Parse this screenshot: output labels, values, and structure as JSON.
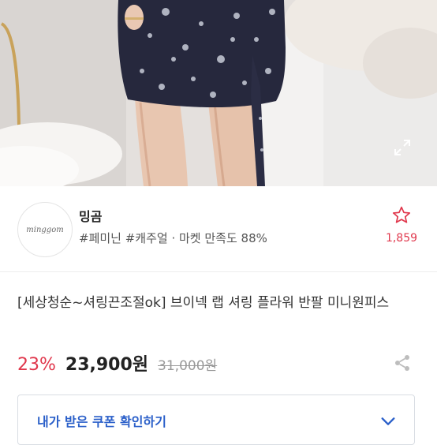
{
  "seller": {
    "logo_text": "minggom",
    "name": "밍곰",
    "tags": "#페미닌 #캐주얼 · 마켓 만족도 88%",
    "favorite_count": "1,859"
  },
  "product": {
    "title": "[세상청순~셔링끈조절ok] 브이넥 랩 셔링 플라워 반팔 미니원피스",
    "discount": "23%",
    "price": "23,900원",
    "original_price": "31,000원"
  },
  "coupon": {
    "label": "내가 받은 쿠폰 확인하기"
  },
  "colors": {
    "accent_red": "#e0374c",
    "coupon_blue": "#2a5fc9"
  },
  "icons": [
    "expand-icon",
    "star-outline-icon",
    "share-icon",
    "chevron-down-icon"
  ]
}
